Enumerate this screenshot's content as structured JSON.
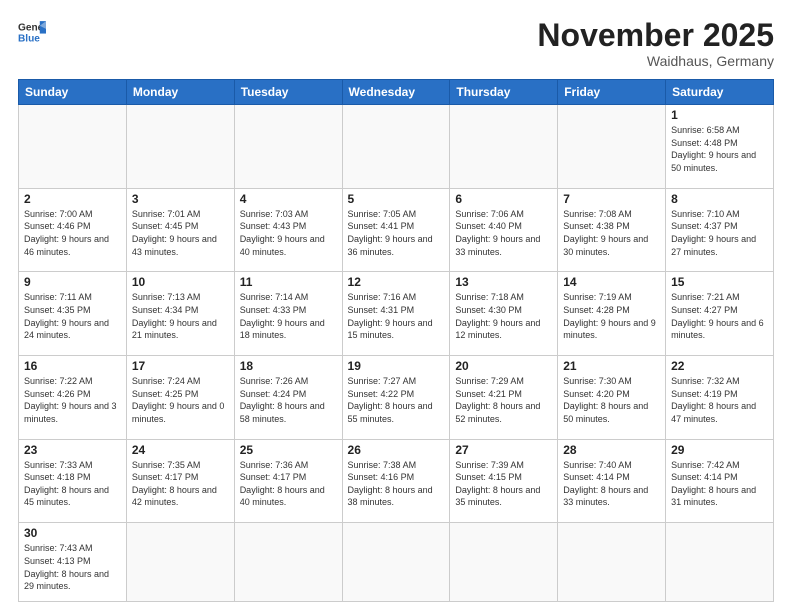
{
  "logo": {
    "line1": "General",
    "line2": "Blue"
  },
  "title": "November 2025",
  "subtitle": "Waidhaus, Germany",
  "days_of_week": [
    "Sunday",
    "Monday",
    "Tuesday",
    "Wednesday",
    "Thursday",
    "Friday",
    "Saturday"
  ],
  "weeks": [
    [
      {
        "day": "",
        "info": ""
      },
      {
        "day": "",
        "info": ""
      },
      {
        "day": "",
        "info": ""
      },
      {
        "day": "",
        "info": ""
      },
      {
        "day": "",
        "info": ""
      },
      {
        "day": "",
        "info": ""
      },
      {
        "day": "1",
        "info": "Sunrise: 6:58 AM\nSunset: 4:48 PM\nDaylight: 9 hours\nand 50 minutes."
      }
    ],
    [
      {
        "day": "2",
        "info": "Sunrise: 7:00 AM\nSunset: 4:46 PM\nDaylight: 9 hours\nand 46 minutes."
      },
      {
        "day": "3",
        "info": "Sunrise: 7:01 AM\nSunset: 4:45 PM\nDaylight: 9 hours\nand 43 minutes."
      },
      {
        "day": "4",
        "info": "Sunrise: 7:03 AM\nSunset: 4:43 PM\nDaylight: 9 hours\nand 40 minutes."
      },
      {
        "day": "5",
        "info": "Sunrise: 7:05 AM\nSunset: 4:41 PM\nDaylight: 9 hours\nand 36 minutes."
      },
      {
        "day": "6",
        "info": "Sunrise: 7:06 AM\nSunset: 4:40 PM\nDaylight: 9 hours\nand 33 minutes."
      },
      {
        "day": "7",
        "info": "Sunrise: 7:08 AM\nSunset: 4:38 PM\nDaylight: 9 hours\nand 30 minutes."
      },
      {
        "day": "8",
        "info": "Sunrise: 7:10 AM\nSunset: 4:37 PM\nDaylight: 9 hours\nand 27 minutes."
      }
    ],
    [
      {
        "day": "9",
        "info": "Sunrise: 7:11 AM\nSunset: 4:35 PM\nDaylight: 9 hours\nand 24 minutes."
      },
      {
        "day": "10",
        "info": "Sunrise: 7:13 AM\nSunset: 4:34 PM\nDaylight: 9 hours\nand 21 minutes."
      },
      {
        "day": "11",
        "info": "Sunrise: 7:14 AM\nSunset: 4:33 PM\nDaylight: 9 hours\nand 18 minutes."
      },
      {
        "day": "12",
        "info": "Sunrise: 7:16 AM\nSunset: 4:31 PM\nDaylight: 9 hours\nand 15 minutes."
      },
      {
        "day": "13",
        "info": "Sunrise: 7:18 AM\nSunset: 4:30 PM\nDaylight: 9 hours\nand 12 minutes."
      },
      {
        "day": "14",
        "info": "Sunrise: 7:19 AM\nSunset: 4:28 PM\nDaylight: 9 hours\nand 9 minutes."
      },
      {
        "day": "15",
        "info": "Sunrise: 7:21 AM\nSunset: 4:27 PM\nDaylight: 9 hours\nand 6 minutes."
      }
    ],
    [
      {
        "day": "16",
        "info": "Sunrise: 7:22 AM\nSunset: 4:26 PM\nDaylight: 9 hours\nand 3 minutes."
      },
      {
        "day": "17",
        "info": "Sunrise: 7:24 AM\nSunset: 4:25 PM\nDaylight: 9 hours\nand 0 minutes."
      },
      {
        "day": "18",
        "info": "Sunrise: 7:26 AM\nSunset: 4:24 PM\nDaylight: 8 hours\nand 58 minutes."
      },
      {
        "day": "19",
        "info": "Sunrise: 7:27 AM\nSunset: 4:22 PM\nDaylight: 8 hours\nand 55 minutes."
      },
      {
        "day": "20",
        "info": "Sunrise: 7:29 AM\nSunset: 4:21 PM\nDaylight: 8 hours\nand 52 minutes."
      },
      {
        "day": "21",
        "info": "Sunrise: 7:30 AM\nSunset: 4:20 PM\nDaylight: 8 hours\nand 50 minutes."
      },
      {
        "day": "22",
        "info": "Sunrise: 7:32 AM\nSunset: 4:19 PM\nDaylight: 8 hours\nand 47 minutes."
      }
    ],
    [
      {
        "day": "23",
        "info": "Sunrise: 7:33 AM\nSunset: 4:18 PM\nDaylight: 8 hours\nand 45 minutes."
      },
      {
        "day": "24",
        "info": "Sunrise: 7:35 AM\nSunset: 4:17 PM\nDaylight: 8 hours\nand 42 minutes."
      },
      {
        "day": "25",
        "info": "Sunrise: 7:36 AM\nSunset: 4:17 PM\nDaylight: 8 hours\nand 40 minutes."
      },
      {
        "day": "26",
        "info": "Sunrise: 7:38 AM\nSunset: 4:16 PM\nDaylight: 8 hours\nand 38 minutes."
      },
      {
        "day": "27",
        "info": "Sunrise: 7:39 AM\nSunset: 4:15 PM\nDaylight: 8 hours\nand 35 minutes."
      },
      {
        "day": "28",
        "info": "Sunrise: 7:40 AM\nSunset: 4:14 PM\nDaylight: 8 hours\nand 33 minutes."
      },
      {
        "day": "29",
        "info": "Sunrise: 7:42 AM\nSunset: 4:14 PM\nDaylight: 8 hours\nand 31 minutes."
      }
    ],
    [
      {
        "day": "30",
        "info": "Sunrise: 7:43 AM\nSunset: 4:13 PM\nDaylight: 8 hours\nand 29 minutes."
      },
      {
        "day": "",
        "info": ""
      },
      {
        "day": "",
        "info": ""
      },
      {
        "day": "",
        "info": ""
      },
      {
        "day": "",
        "info": ""
      },
      {
        "day": "",
        "info": ""
      },
      {
        "day": "",
        "info": ""
      }
    ]
  ]
}
